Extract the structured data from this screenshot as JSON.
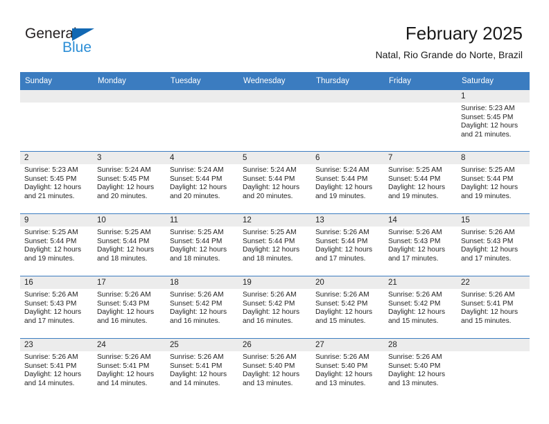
{
  "logo": {
    "word1": "General",
    "word2": "Blue",
    "triangle_color": "#1268b3",
    "word2_color": "#2c8ed6"
  },
  "header": {
    "month_title": "February 2025",
    "location": "Natal, Rio Grande do Norte, Brazil",
    "accent_color": "#3b7cc0",
    "daynum_band_color": "#ececec"
  },
  "weekday_headers": [
    "Sunday",
    "Monday",
    "Tuesday",
    "Wednesday",
    "Thursday",
    "Friday",
    "Saturday"
  ],
  "weeks": [
    [
      {
        "day": "",
        "sunrise": "",
        "sunset": "",
        "daylight_line1": "",
        "daylight_line2": ""
      },
      {
        "day": "",
        "sunrise": "",
        "sunset": "",
        "daylight_line1": "",
        "daylight_line2": ""
      },
      {
        "day": "",
        "sunrise": "",
        "sunset": "",
        "daylight_line1": "",
        "daylight_line2": ""
      },
      {
        "day": "",
        "sunrise": "",
        "sunset": "",
        "daylight_line1": "",
        "daylight_line2": ""
      },
      {
        "day": "",
        "sunrise": "",
        "sunset": "",
        "daylight_line1": "",
        "daylight_line2": ""
      },
      {
        "day": "",
        "sunrise": "",
        "sunset": "",
        "daylight_line1": "",
        "daylight_line2": ""
      },
      {
        "day": "1",
        "sunrise": "Sunrise: 5:23 AM",
        "sunset": "Sunset: 5:45 PM",
        "daylight_line1": "Daylight: 12 hours",
        "daylight_line2": "and 21 minutes."
      }
    ],
    [
      {
        "day": "2",
        "sunrise": "Sunrise: 5:23 AM",
        "sunset": "Sunset: 5:45 PM",
        "daylight_line1": "Daylight: 12 hours",
        "daylight_line2": "and 21 minutes."
      },
      {
        "day": "3",
        "sunrise": "Sunrise: 5:24 AM",
        "sunset": "Sunset: 5:45 PM",
        "daylight_line1": "Daylight: 12 hours",
        "daylight_line2": "and 20 minutes."
      },
      {
        "day": "4",
        "sunrise": "Sunrise: 5:24 AM",
        "sunset": "Sunset: 5:44 PM",
        "daylight_line1": "Daylight: 12 hours",
        "daylight_line2": "and 20 minutes."
      },
      {
        "day": "5",
        "sunrise": "Sunrise: 5:24 AM",
        "sunset": "Sunset: 5:44 PM",
        "daylight_line1": "Daylight: 12 hours",
        "daylight_line2": "and 20 minutes."
      },
      {
        "day": "6",
        "sunrise": "Sunrise: 5:24 AM",
        "sunset": "Sunset: 5:44 PM",
        "daylight_line1": "Daylight: 12 hours",
        "daylight_line2": "and 19 minutes."
      },
      {
        "day": "7",
        "sunrise": "Sunrise: 5:25 AM",
        "sunset": "Sunset: 5:44 PM",
        "daylight_line1": "Daylight: 12 hours",
        "daylight_line2": "and 19 minutes."
      },
      {
        "day": "8",
        "sunrise": "Sunrise: 5:25 AM",
        "sunset": "Sunset: 5:44 PM",
        "daylight_line1": "Daylight: 12 hours",
        "daylight_line2": "and 19 minutes."
      }
    ],
    [
      {
        "day": "9",
        "sunrise": "Sunrise: 5:25 AM",
        "sunset": "Sunset: 5:44 PM",
        "daylight_line1": "Daylight: 12 hours",
        "daylight_line2": "and 19 minutes."
      },
      {
        "day": "10",
        "sunrise": "Sunrise: 5:25 AM",
        "sunset": "Sunset: 5:44 PM",
        "daylight_line1": "Daylight: 12 hours",
        "daylight_line2": "and 18 minutes."
      },
      {
        "day": "11",
        "sunrise": "Sunrise: 5:25 AM",
        "sunset": "Sunset: 5:44 PM",
        "daylight_line1": "Daylight: 12 hours",
        "daylight_line2": "and 18 minutes."
      },
      {
        "day": "12",
        "sunrise": "Sunrise: 5:25 AM",
        "sunset": "Sunset: 5:44 PM",
        "daylight_line1": "Daylight: 12 hours",
        "daylight_line2": "and 18 minutes."
      },
      {
        "day": "13",
        "sunrise": "Sunrise: 5:26 AM",
        "sunset": "Sunset: 5:44 PM",
        "daylight_line1": "Daylight: 12 hours",
        "daylight_line2": "and 17 minutes."
      },
      {
        "day": "14",
        "sunrise": "Sunrise: 5:26 AM",
        "sunset": "Sunset: 5:43 PM",
        "daylight_line1": "Daylight: 12 hours",
        "daylight_line2": "and 17 minutes."
      },
      {
        "day": "15",
        "sunrise": "Sunrise: 5:26 AM",
        "sunset": "Sunset: 5:43 PM",
        "daylight_line1": "Daylight: 12 hours",
        "daylight_line2": "and 17 minutes."
      }
    ],
    [
      {
        "day": "16",
        "sunrise": "Sunrise: 5:26 AM",
        "sunset": "Sunset: 5:43 PM",
        "daylight_line1": "Daylight: 12 hours",
        "daylight_line2": "and 17 minutes."
      },
      {
        "day": "17",
        "sunrise": "Sunrise: 5:26 AM",
        "sunset": "Sunset: 5:43 PM",
        "daylight_line1": "Daylight: 12 hours",
        "daylight_line2": "and 16 minutes."
      },
      {
        "day": "18",
        "sunrise": "Sunrise: 5:26 AM",
        "sunset": "Sunset: 5:42 PM",
        "daylight_line1": "Daylight: 12 hours",
        "daylight_line2": "and 16 minutes."
      },
      {
        "day": "19",
        "sunrise": "Sunrise: 5:26 AM",
        "sunset": "Sunset: 5:42 PM",
        "daylight_line1": "Daylight: 12 hours",
        "daylight_line2": "and 16 minutes."
      },
      {
        "day": "20",
        "sunrise": "Sunrise: 5:26 AM",
        "sunset": "Sunset: 5:42 PM",
        "daylight_line1": "Daylight: 12 hours",
        "daylight_line2": "and 15 minutes."
      },
      {
        "day": "21",
        "sunrise": "Sunrise: 5:26 AM",
        "sunset": "Sunset: 5:42 PM",
        "daylight_line1": "Daylight: 12 hours",
        "daylight_line2": "and 15 minutes."
      },
      {
        "day": "22",
        "sunrise": "Sunrise: 5:26 AM",
        "sunset": "Sunset: 5:41 PM",
        "daylight_line1": "Daylight: 12 hours",
        "daylight_line2": "and 15 minutes."
      }
    ],
    [
      {
        "day": "23",
        "sunrise": "Sunrise: 5:26 AM",
        "sunset": "Sunset: 5:41 PM",
        "daylight_line1": "Daylight: 12 hours",
        "daylight_line2": "and 14 minutes."
      },
      {
        "day": "24",
        "sunrise": "Sunrise: 5:26 AM",
        "sunset": "Sunset: 5:41 PM",
        "daylight_line1": "Daylight: 12 hours",
        "daylight_line2": "and 14 minutes."
      },
      {
        "day": "25",
        "sunrise": "Sunrise: 5:26 AM",
        "sunset": "Sunset: 5:41 PM",
        "daylight_line1": "Daylight: 12 hours",
        "daylight_line2": "and 14 minutes."
      },
      {
        "day": "26",
        "sunrise": "Sunrise: 5:26 AM",
        "sunset": "Sunset: 5:40 PM",
        "daylight_line1": "Daylight: 12 hours",
        "daylight_line2": "and 13 minutes."
      },
      {
        "day": "27",
        "sunrise": "Sunrise: 5:26 AM",
        "sunset": "Sunset: 5:40 PM",
        "daylight_line1": "Daylight: 12 hours",
        "daylight_line2": "and 13 minutes."
      },
      {
        "day": "28",
        "sunrise": "Sunrise: 5:26 AM",
        "sunset": "Sunset: 5:40 PM",
        "daylight_line1": "Daylight: 12 hours",
        "daylight_line2": "and 13 minutes."
      },
      {
        "day": "",
        "sunrise": "",
        "sunset": "",
        "daylight_line1": "",
        "daylight_line2": ""
      }
    ]
  ]
}
